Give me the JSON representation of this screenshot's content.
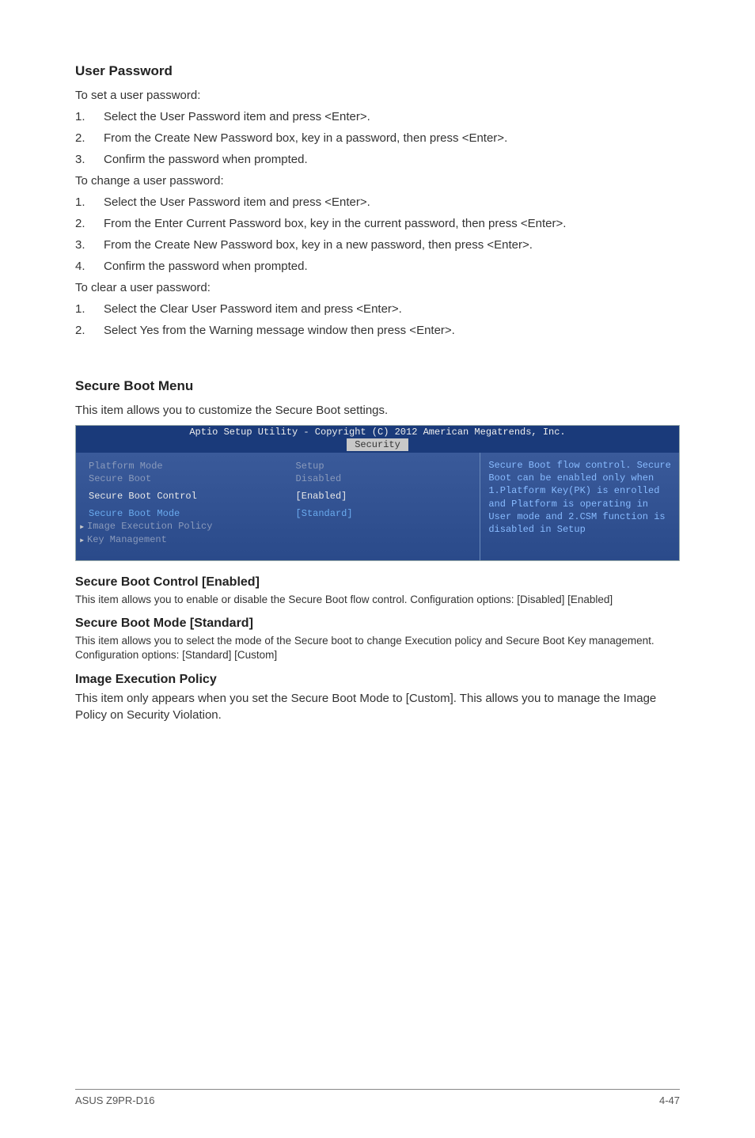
{
  "sections": {
    "userPassword": {
      "heading": "User Password",
      "setIntro": "To set a user password:",
      "setSteps": [
        "Select the User Password item and press <Enter>.",
        "From the Create New Password box, key in a password, then press <Enter>.",
        "Confirm the password when prompted."
      ],
      "changeIntro": "To change a user password:",
      "changeSteps": [
        "Select the User Password item and press <Enter>.",
        "From the Enter Current Password box, key in the current password, then press <Enter>.",
        "From the Create New Password box, key in a new password, then press <Enter>.",
        "Confirm the password when prompted."
      ],
      "clearIntro": "To clear a user password:",
      "clearSteps": [
        "Select the Clear User Password item and press <Enter>.",
        "Select Yes from the Warning message window then press <Enter>."
      ]
    },
    "secureBoot": {
      "heading": "Secure Boot Menu",
      "intro": "This item allows you to customize the Secure Boot settings."
    },
    "bios": {
      "header": "Aptio Setup Utility - Copyright (C) 2012 American Megatrends, Inc.",
      "tab": "Security",
      "rows": [
        {
          "label": "Platform Mode",
          "value": "Setup",
          "style": "gray"
        },
        {
          "label": "Secure Boot",
          "value": "Disabled",
          "style": "gray"
        },
        {
          "label": "Secure Boot Control",
          "value": "[Enabled]",
          "style": "white"
        },
        {
          "label": "Secure Boot Mode",
          "value": "[Standard]",
          "style": "blue"
        },
        {
          "label": "Image Execution Policy",
          "value": "",
          "style": "gray",
          "arrow": true
        },
        {
          "label": "Key Management",
          "value": "",
          "style": "gray",
          "arrow": true
        }
      ],
      "help": "Secure Boot flow control. Secure Boot can be enabled only when 1.Platform Key(PK) is enrolled and Platform is operating in User mode and 2.CSM function is disabled in Setup"
    },
    "items": {
      "sbc": {
        "heading": "Secure Boot Control [Enabled]",
        "desc": "This item allows you to enable or disable the Secure Boot flow control. Configuration options: [Disabled] [Enabled]"
      },
      "sbm": {
        "heading": "Secure Boot Mode [Standard]",
        "desc": "This item allows you to select the mode of the Secure boot to change Execution policy and Secure Boot Key management. Configuration options: [Standard] [Custom]"
      },
      "iep": {
        "heading": "Image Execution Policy",
        "desc": "This item only appears when you set the Secure Boot Mode to [Custom]. This allows you to manage the Image Policy on Security Violation."
      }
    }
  },
  "footer": {
    "left": "ASUS Z9PR-D16",
    "right": "4-47"
  }
}
